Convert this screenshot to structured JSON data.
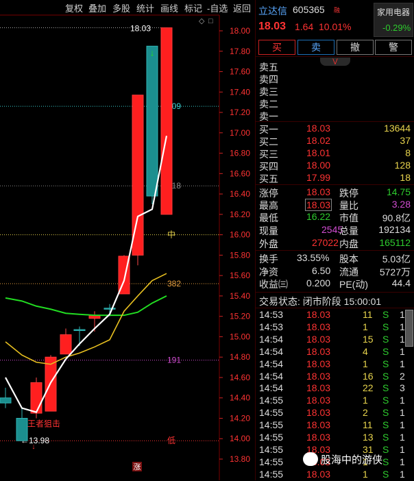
{
  "toolbar": [
    "复权",
    "叠加",
    "多股",
    "统计",
    "画线",
    "标记",
    "-自选",
    "返回"
  ],
  "chart_data": {
    "type": "candlestick",
    "ylim": [
      13.7,
      18.1
    ],
    "y_ticks": [
      "18.00",
      "17.80",
      "17.60",
      "17.40",
      "17.20",
      "17.00",
      "16.80",
      "16.60",
      "16.40",
      "16.20",
      "16.00",
      "15.80",
      "15.60",
      "15.40",
      "15.20",
      "15.00",
      "14.80",
      "14.60",
      "14.40",
      "14.20",
      "14.00",
      "13.80"
    ],
    "candles": [
      {
        "o": 14.4,
        "c": 14.35,
        "h": 14.5,
        "l": 14.3
      },
      {
        "o": 14.2,
        "c": 13.98,
        "h": 14.3,
        "l": 13.98
      },
      {
        "o": 14.25,
        "c": 14.55,
        "h": 14.6,
        "l": 14.2
      },
      {
        "o": 14.27,
        "c": 14.8,
        "h": 14.82,
        "l": 14.27
      },
      {
        "o": 14.83,
        "c": 15.02,
        "h": 15.08,
        "l": 14.83
      },
      {
        "o": 15.07,
        "c": 15.06,
        "h": 15.1,
        "l": 14.91
      },
      {
        "o": 15.18,
        "c": 15.21,
        "h": 15.25,
        "l": 15.05
      },
      {
        "o": 15.28,
        "c": 15.27,
        "h": 15.32,
        "l": 15.2
      },
      {
        "o": 15.42,
        "c": 15.79,
        "h": 15.8,
        "l": 15.42
      },
      {
        "o": 15.8,
        "c": 17.37,
        "h": 17.37,
        "l": 15.7
      },
      {
        "o": 17.85,
        "c": 16.38,
        "h": 17.85,
        "l": 16.3
      },
      {
        "o": 16.2,
        "c": 18.03,
        "h": 18.03,
        "l": 16.2
      }
    ],
    "levels": [
      {
        "label": "809",
        "value": 17.26,
        "color": "#38d0d0"
      },
      {
        "label": "618",
        "value": 16.48,
        "color": "#888888"
      },
      {
        "label": "中",
        "value": 16.0,
        "color": "#e8d44d"
      },
      {
        "label": "382",
        "value": 15.52,
        "color": "#e8a040"
      },
      {
        "label": "191",
        "value": 14.77,
        "color": "#d24dd2"
      },
      {
        "label": "低",
        "value": 13.98,
        "color": "#ff3333"
      }
    ],
    "annotations": {
      "high": "18.03",
      "low": "13.98",
      "signal": "王者狙击",
      "limit": "涨"
    },
    "ma_white": [
      14.6,
      14.3,
      14.26,
      14.55,
      14.78,
      14.93,
      15.08,
      15.22,
      15.55,
      16.18,
      16.25,
      16.97
    ],
    "ma_yellow": [
      14.95,
      14.82,
      14.75,
      14.73,
      14.8,
      14.84,
      14.9,
      14.97,
      15.25,
      15.4,
      15.55,
      15.62
    ],
    "ma_green": [
      15.38,
      15.35,
      15.3,
      15.27,
      15.23,
      15.22,
      15.21,
      15.21,
      15.21,
      15.24,
      15.33,
      15.4
    ]
  },
  "stock": {
    "name": "立达信",
    "code": "605365",
    "tag": "融",
    "industry": "家用电器",
    "industry_pct": "-0.29%",
    "price": "18.03",
    "change": "1.64",
    "change_pct": "10.01%"
  },
  "buttons": {
    "buy": "买",
    "sell": "卖",
    "cancel": "撤",
    "alert": "警"
  },
  "asks": [
    {
      "label": "卖五",
      "price": "",
      "vol": ""
    },
    {
      "label": "卖四",
      "price": "",
      "vol": ""
    },
    {
      "label": "卖三",
      "price": "",
      "vol": ""
    },
    {
      "label": "卖二",
      "price": "",
      "vol": ""
    },
    {
      "label": "卖一",
      "price": "",
      "vol": ""
    }
  ],
  "bids": [
    {
      "label": "买一",
      "price": "18.03",
      "vol": "13644"
    },
    {
      "label": "买二",
      "price": "18.02",
      "vol": "37"
    },
    {
      "label": "买三",
      "price": "18.01",
      "vol": "8"
    },
    {
      "label": "买四",
      "price": "18.00",
      "vol": "128"
    },
    {
      "label": "买五",
      "price": "17.99",
      "vol": "18"
    }
  ],
  "quote": {
    "limit_up_label": "涨停",
    "limit_up": "18.03",
    "limit_down_label": "跌停",
    "limit_down": "14.75",
    "high_label": "最高",
    "high": "18.03",
    "vol_ratio_label": "量比",
    "vol_ratio": "3.28",
    "low_label": "最低",
    "low": "16.22",
    "mcap_label": "市值",
    "mcap": "90.8亿",
    "cur_vol_label": "现量",
    "cur_vol": "2545",
    "total_vol_label": "总量",
    "total_vol": "192134",
    "outer_label": "外盘",
    "outer": "27022",
    "inner_label": "内盘",
    "inner": "165112",
    "turnover_label": "换手",
    "turnover": "33.55%",
    "share_cap_label": "股本",
    "share_cap": "5.03亿",
    "nav_label": "净资",
    "nav": "6.50",
    "float_label": "流通",
    "float": "5727万",
    "eps_label": "收益㈢",
    "eps": "0.200",
    "pe_label": "PE(动)",
    "pe": "44.4"
  },
  "status": "交易状态: 闭市阶段 15:00:01",
  "ticks": [
    {
      "t": "14:53",
      "p": "18.03",
      "v": "11",
      "s": "S",
      "n": "1"
    },
    {
      "t": "14:53",
      "p": "18.03",
      "v": "1",
      "s": "S",
      "n": "1"
    },
    {
      "t": "14:54",
      "p": "18.03",
      "v": "15",
      "s": "S",
      "n": "1"
    },
    {
      "t": "14:54",
      "p": "18.03",
      "v": "4",
      "s": "S",
      "n": "1"
    },
    {
      "t": "14:54",
      "p": "18.03",
      "v": "1",
      "s": "S",
      "n": "1"
    },
    {
      "t": "14:54",
      "p": "18.03",
      "v": "16",
      "s": "S",
      "n": "2"
    },
    {
      "t": "14:54",
      "p": "18.03",
      "v": "22",
      "s": "S",
      "n": "3"
    },
    {
      "t": "14:55",
      "p": "18.03",
      "v": "1",
      "s": "S",
      "n": "1"
    },
    {
      "t": "14:55",
      "p": "18.03",
      "v": "2",
      "s": "S",
      "n": "1"
    },
    {
      "t": "14:55",
      "p": "18.03",
      "v": "11",
      "s": "S",
      "n": "1"
    },
    {
      "t": "14:55",
      "p": "18.03",
      "v": "13",
      "s": "S",
      "n": "1"
    },
    {
      "t": "14:55",
      "p": "18.03",
      "v": "31",
      "s": "S",
      "n": "1"
    },
    {
      "t": "14:55",
      "p": "18.03",
      "v": "1",
      "s": "S",
      "n": "1"
    },
    {
      "t": "14:55",
      "p": "18.03",
      "v": "1",
      "s": "S",
      "n": "1"
    }
  ],
  "watermark": "股海中的游侠"
}
